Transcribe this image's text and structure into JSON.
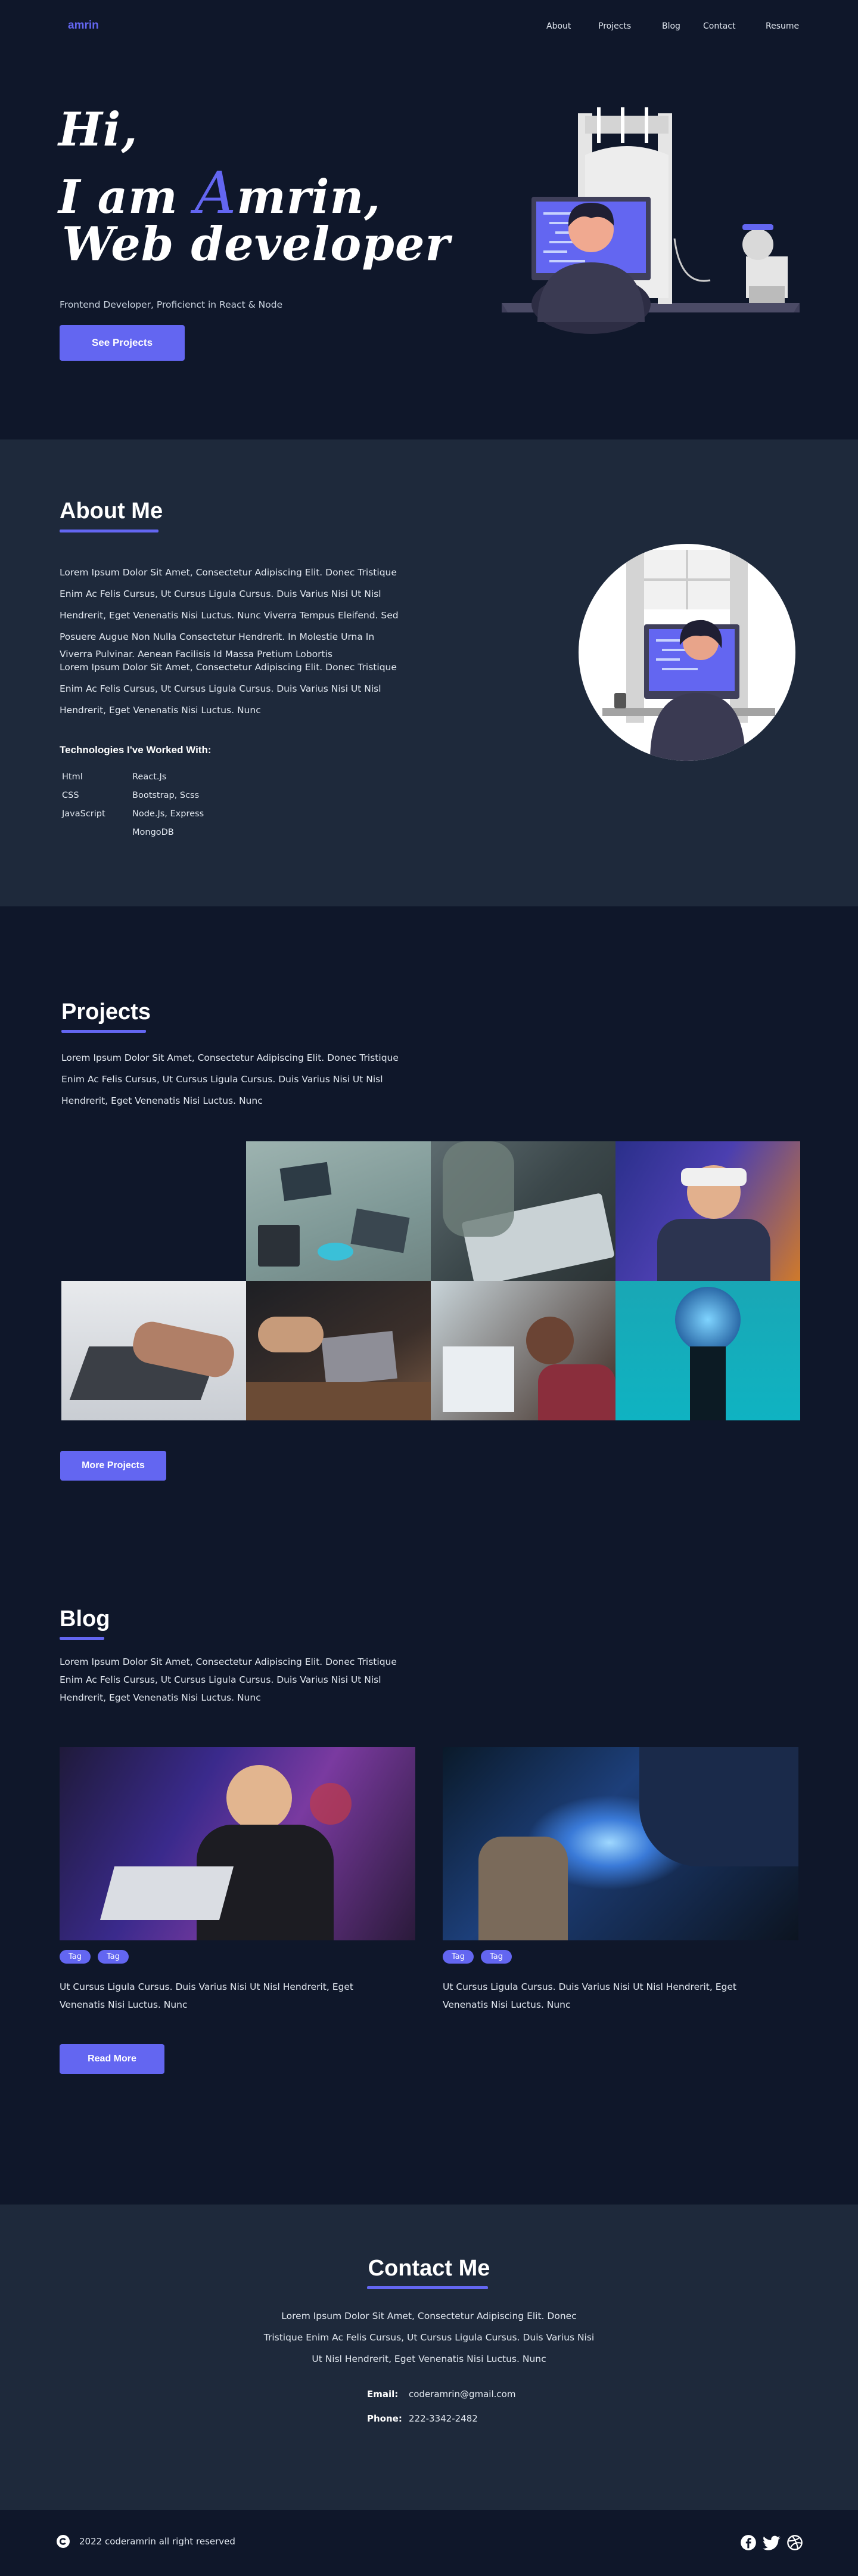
{
  "nav": {
    "logo": "amrin",
    "items": [
      "About",
      "Projects",
      "Blog",
      "Contact",
      "Resume"
    ]
  },
  "hero": {
    "line1": "Hi,",
    "line2_pre": "I am ",
    "line2_accent": "A",
    "line2_post": "mrin,",
    "line3": "Web developer",
    "subtitle": "Frontend Developer, Proficienct in React & Node",
    "cta": "See Projects"
  },
  "about": {
    "title": "About Me",
    "lines": [
      "Lorem Ipsum Dolor Sit Amet, Consectetur Adipiscing Elit. Donec Tristique",
      "Enim Ac Felis Cursus, Ut Cursus Ligula Cursus. Duis Varius Nisi Ut Nisl",
      "Hendrerit, Eget Venenatis Nisi Luctus. Nunc Viverra Tempus Eleifend. Sed",
      "Posuere Augue Non Nulla Consectetur Hendrerit. In Molestie Urna In",
      "Viverra Pulvinar. Aenean Facilisis Id Massa Pretium Lobortis",
      "Lorem Ipsum Dolor Sit Amet, Consectetur Adipiscing Elit. Donec Tristique",
      "Enim Ac Felis Cursus, Ut Cursus Ligula Cursus. Duis Varius Nisi Ut Nisl",
      "Hendrerit, Eget Venenatis Nisi Luctus. Nunc"
    ],
    "tech_title": "Technologies I've Worked With:",
    "tech_left": [
      "Html",
      "CSS",
      "JavaScript"
    ],
    "tech_right": [
      "React.Js",
      "Bootstrap, Scss",
      "Node.Js, Express",
      "MongoDB"
    ]
  },
  "projects": {
    "title": "Projects",
    "lines": [
      "Lorem Ipsum Dolor Sit Amet, Consectetur Adipiscing Elit. Donec Tristique",
      "Enim Ac Felis Cursus, Ut Cursus Ligula Cursus. Duis Varius Nisi Ut Nisl",
      "Hendrerit, Eget Venenatis Nisi Luctus. Nunc"
    ],
    "cta": "More Projects"
  },
  "blog": {
    "title": "Blog",
    "lines": [
      "Lorem Ipsum Dolor Sit Amet, Consectetur Adipiscing Elit. Donec Tristique",
      "Enim Ac Felis Cursus, Ut Cursus Ligula Cursus. Duis Varius Nisi Ut Nisl",
      "Hendrerit, Eget Venenatis Nisi Luctus. Nunc"
    ],
    "posts": [
      {
        "tags": [
          "Tag",
          "Tag"
        ],
        "excerpt1": "Ut Cursus Ligula Cursus. Duis Varius Nisi Ut Nisl Hendrerit, Eget",
        "excerpt2": "Venenatis Nisi Luctus. Nunc"
      },
      {
        "tags": [
          "Tag",
          "Tag"
        ],
        "excerpt1": "Ut Cursus Ligula Cursus. Duis Varius Nisi Ut Nisl Hendrerit, Eget",
        "excerpt2": "Venenatis Nisi Luctus. Nunc"
      }
    ],
    "cta": "Read More"
  },
  "contact": {
    "title": "Contact Me",
    "lines": [
      "Lorem Ipsum Dolor Sit Amet, Consectetur Adipiscing Elit. Donec",
      "Tristique Enim Ac Felis Cursus, Ut Cursus Ligula Cursus. Duis Varius Nisi",
      "Ut Nisl Hendrerit, Eget Venenatis Nisi Luctus. Nunc"
    ],
    "email_label": "Email:",
    "email": "coderamrin@gmail.com",
    "phone_label": "Phone:",
    "phone": "222-3342-2482"
  },
  "footer": {
    "copyright": "2022 coderamrin all right reserved",
    "social_icons": [
      "facebook-icon",
      "twitter-icon",
      "dribbble-icon"
    ]
  },
  "colors": {
    "accent": "#6366f1",
    "bg_dark": "#0f172a",
    "bg_section": "#1e293b"
  }
}
